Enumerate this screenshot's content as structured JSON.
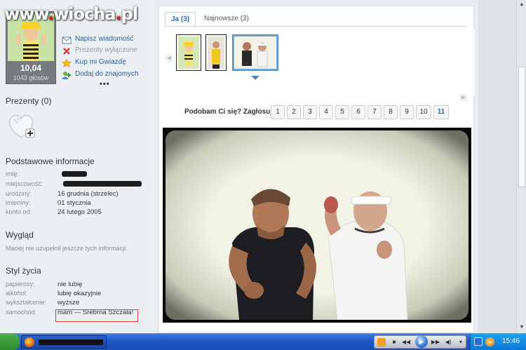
{
  "watermark": {
    "a": "www",
    "b": "wiocha",
    "c": "pl"
  },
  "profile": {
    "score": "10,04",
    "votes": "1043 głosów",
    "actions": [
      {
        "label": "Napisz wiadomość",
        "icon": "envelope-icon",
        "enabled": true
      },
      {
        "label": "Prezenty wyłączone",
        "icon": "close-icon",
        "enabled": false
      },
      {
        "label": "Kup mi Gwiazdę",
        "icon": "star-icon",
        "enabled": true
      },
      {
        "label": "Dodaj do znajomych",
        "icon": "add-friend-icon",
        "enabled": true
      }
    ],
    "more": "•••"
  },
  "gifts": {
    "title": "Prezenty (0)",
    "icon": "gift-heart-icon"
  },
  "basic_info": {
    "title": "Podstawowe informacje",
    "rows": [
      {
        "key": "imię:",
        "value": ""
      },
      {
        "key": "miejscowość:",
        "value": ""
      },
      {
        "key": "urodziny:",
        "value": "16 grudnia (strzelec)"
      },
      {
        "key": "imieniny:",
        "value": "01 stycznia"
      },
      {
        "key": "konto od:",
        "value": "24 lutego 2005"
      }
    ]
  },
  "appearance": {
    "title": "Wygląd",
    "note": "Maciej nie uzupełnił jeszcze tych informacji."
  },
  "lifestyle": {
    "title": "Styl życia",
    "rows": [
      {
        "key": "papierosy:",
        "value": "nie lubię"
      },
      {
        "key": "alkohol:",
        "value": "lubię okazyjnie"
      },
      {
        "key": "wykształcenie:",
        "value": "wyższe"
      },
      {
        "key": "samochód:",
        "value": "mam — Srebrna Szczała!"
      }
    ]
  },
  "tabs": {
    "active": "Ja (3)",
    "other": "Najnowsze (3)"
  },
  "rating": {
    "label": "Podobam Ci się? Zagłosuj:",
    "options": [
      "1",
      "2",
      "3",
      "4",
      "5",
      "6",
      "7",
      "8",
      "9",
      "10",
      "11"
    ]
  },
  "taskbar": {
    "clock": "15:46"
  },
  "colors": {
    "accent": "#2a6ab5",
    "taskbar": "#1f56c4",
    "highlight_box": "#d84040"
  }
}
